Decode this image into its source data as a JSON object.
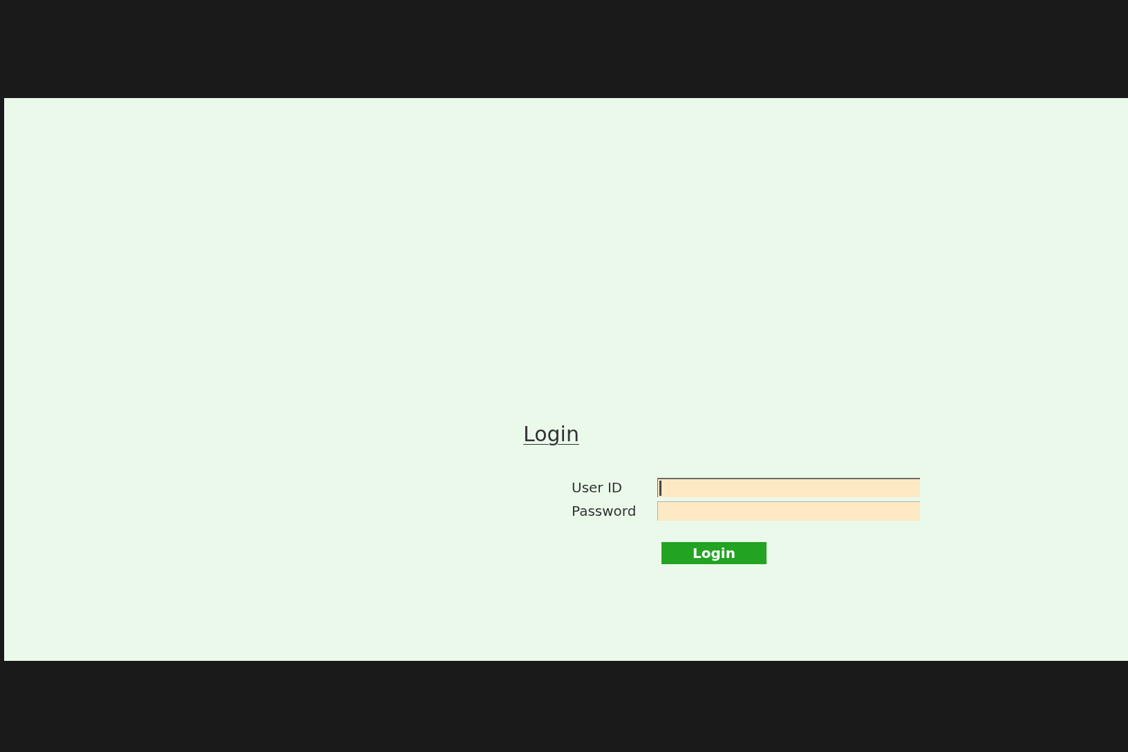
{
  "login": {
    "heading": "Login",
    "fields": [
      {
        "label": "User ID",
        "focused": true
      },
      {
        "label": "Password",
        "focused": false
      }
    ],
    "button": "Login"
  }
}
